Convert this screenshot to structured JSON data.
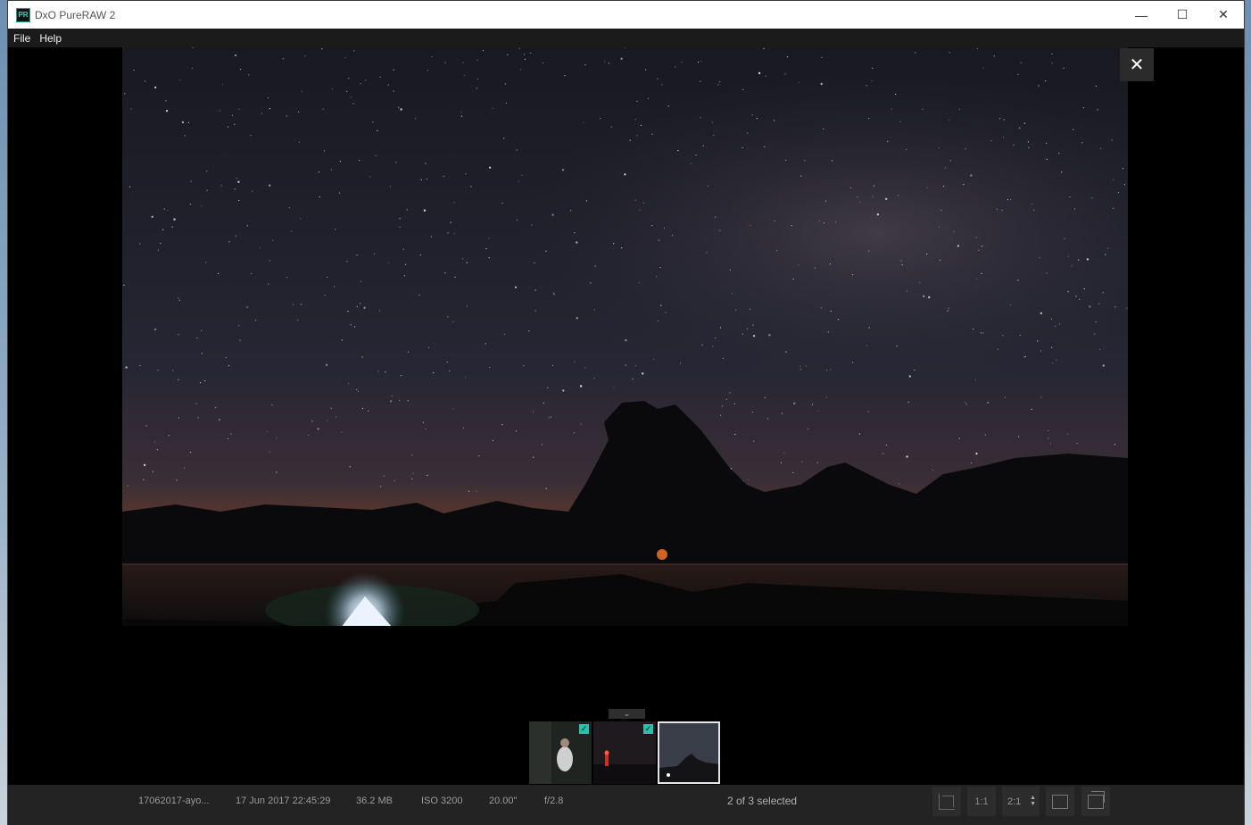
{
  "window": {
    "logo_text": "PR",
    "title": "DxO PureRAW 2",
    "minimize": "—",
    "maximize": "☐",
    "close": "✕"
  },
  "menu": [
    "File",
    "Help"
  ],
  "viewer": {
    "close": "✕",
    "filmstrip_toggle": "⌄"
  },
  "thumbnails": [
    {
      "name": "portrait-photo",
      "checked": true,
      "active": false
    },
    {
      "name": "lighthouse-photo",
      "checked": true,
      "active": false
    },
    {
      "name": "mountain-night-photo",
      "checked": false,
      "active": true
    }
  ],
  "status": {
    "filename": "17062017-ayo...",
    "datetime": "17 Jun 2017 22:45:29",
    "filesize": "36.2 MB",
    "iso": "ISO 3200",
    "shutter": "20.00\"",
    "aperture": "f/2.8",
    "selection": "2 of 3 selected",
    "zoom_fit": "1:1",
    "zoom_level": "2:1",
    "check_mark": "✓"
  },
  "colors": {
    "accent": "#2bbfae",
    "statusbar": "#232323"
  }
}
